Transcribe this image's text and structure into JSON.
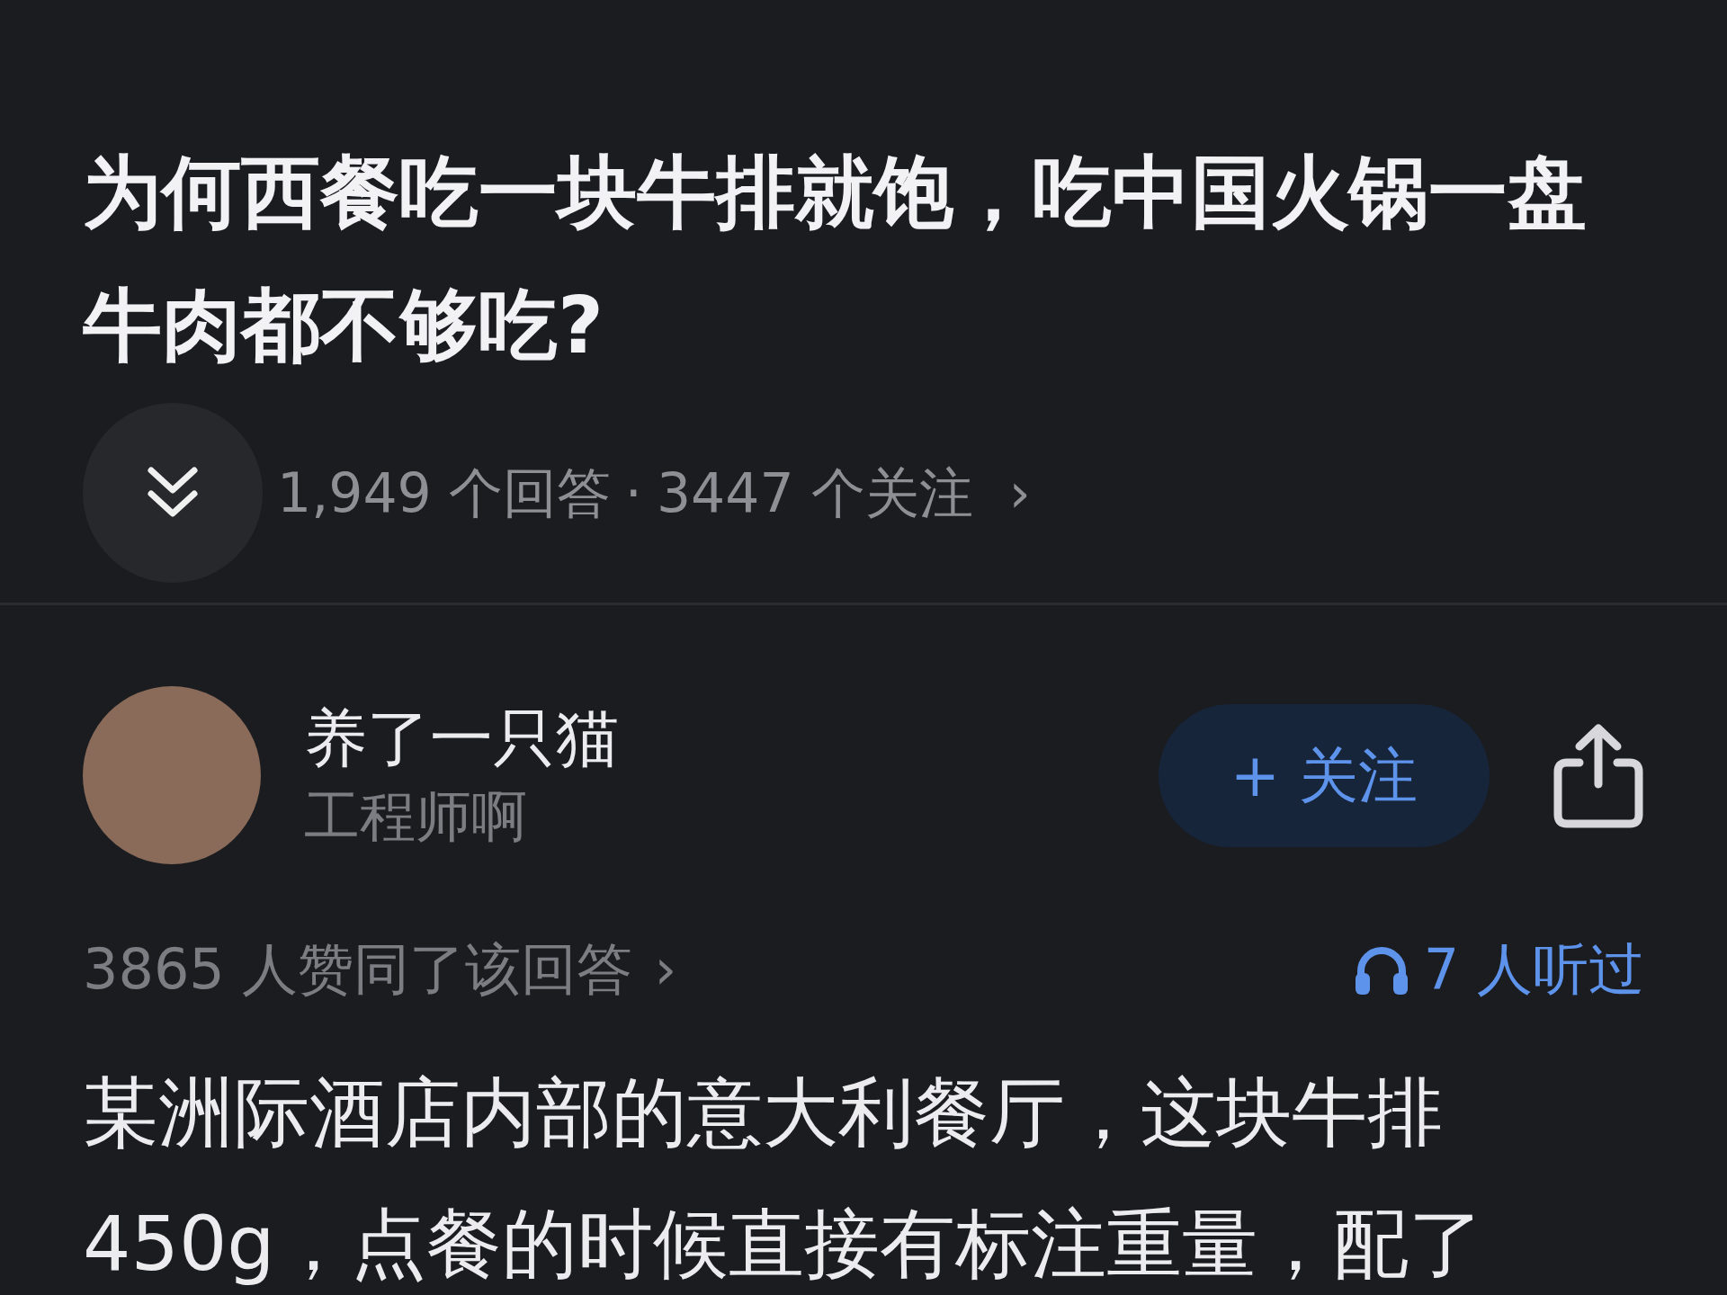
{
  "question": {
    "title": "为何西餐吃一块牛排就饱，吃中国火锅一盘牛肉都不够吃?",
    "answers_count": "1,949 个回答",
    "separator": "·",
    "followers_count": "3447 个关注",
    "chevron": "›"
  },
  "answer": {
    "author": {
      "name": "养了一只猫",
      "bio": "工程师啊"
    },
    "follow_button": "+ 关注",
    "agree_text": "3865 人赞同了该回答",
    "agree_chevron": "›",
    "listen_text": "7 人听过",
    "body": "某洲际酒店内部的意大利餐厅，这块牛排450g，点餐的时候直接有标注重量，配了"
  }
}
